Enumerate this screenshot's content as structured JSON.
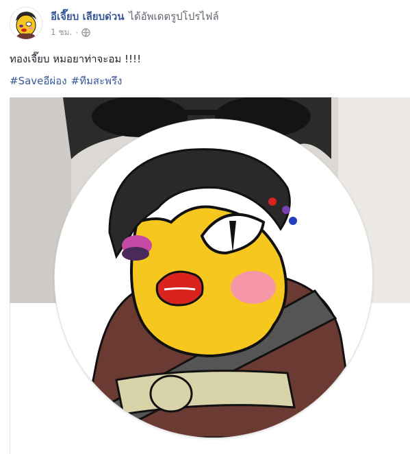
{
  "post": {
    "author_name": "อีเจี๊ยบ เลียบด่วน",
    "action_text": "ได้อัพเดตรูปโปรไฟล์",
    "timestamp": "1 ชม.",
    "separator": "·",
    "privacy_icon": "globe-icon",
    "text": "ทองเจี๊ยบ หมอยาท่าจะอม !!!!",
    "hashtags": [
      "#Saveอีผ่อง",
      "#ทีมสะพรึง"
    ]
  },
  "colors": {
    "link": "#385898",
    "meta": "#90949c",
    "text": "#1d2129"
  }
}
